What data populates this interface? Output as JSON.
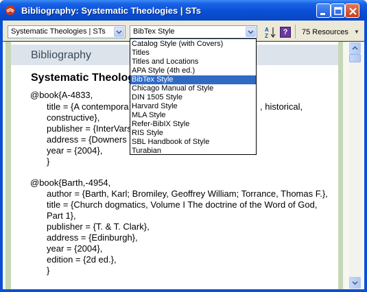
{
  "window": {
    "title": "Bibliography: Systematic Theologies | STs"
  },
  "toolbar": {
    "resource_combo_value": "Systematic Theologies | STs",
    "style_combo_value": "BibTex Style",
    "resources_count": "75 Resources"
  },
  "dropdown": {
    "items": [
      "Catalog Style (with Covers)",
      "Titles",
      "Titles and Locations",
      "APA Style (4th ed.)",
      "BibTex Style",
      "Chicago Manual of Style",
      "DIN 1505 Style",
      "Harvard Style",
      "MLA Style",
      "Refer-BibIX Style",
      "RIS Style",
      "SBL Handbook of Style",
      "Turabian"
    ],
    "selected_index": 4
  },
  "document": {
    "header": "Bibliography",
    "title": "Systematic Theolog",
    "lines": [
      "@book{A-4833,",
      "title = {A contempora",
      ", historical,",
      "constructive},",
      "publisher = {InterVars",
      "address = {Downers",
      "year = {2004},",
      "}",
      "@book{Barth,-4954,",
      "author = {Barth, Karl; Bromiley, Geoffrey William; Torrance, Thomas F.},",
      "title = {Church dogmatics, Volume I The doctrine of the Word of God,",
      "Part 1},",
      "publisher = {T. & T. Clark},",
      "address = {Edinburgh},",
      "year = {2004},",
      "edition = {2d ed.},",
      "}"
    ]
  },
  "colors": {
    "titlebar": "#0a4fd6",
    "selection": "#316ac5",
    "side_bars": "#c6d7b8",
    "toolbar_bg": "#ece9d8"
  },
  "icons": [
    "app-icon",
    "minimize-icon",
    "maximize-icon",
    "close-icon",
    "chevron-down-icon",
    "sort-az-icon",
    "help-icon",
    "scroll-up-icon",
    "scroll-down-icon"
  ]
}
